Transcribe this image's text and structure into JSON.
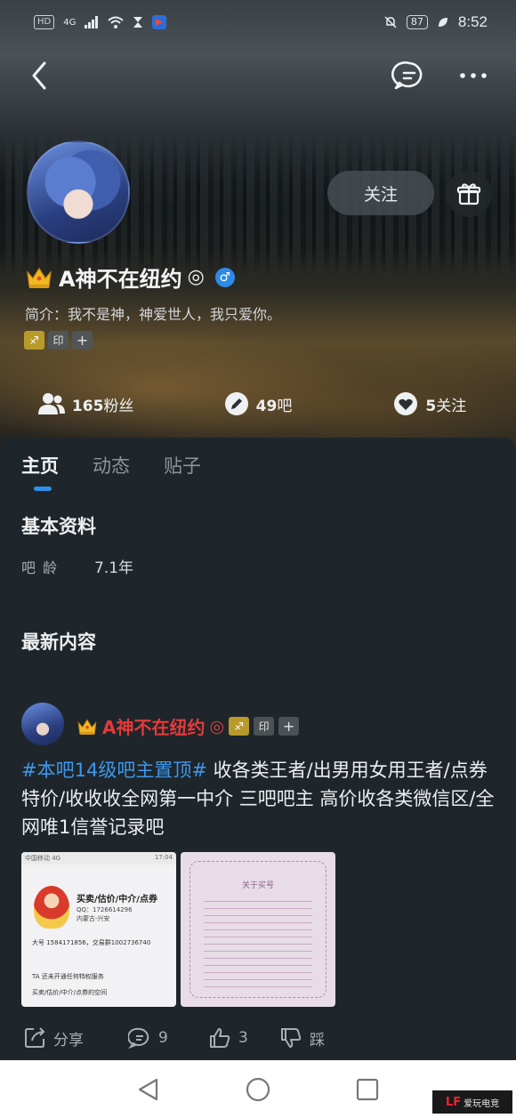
{
  "status_bar": {
    "left_hd": "HD",
    "left_net": "4G",
    "battery": "87",
    "time": "8:52"
  },
  "profile": {
    "username": "A神不在纽约",
    "ring_symbol": "◎",
    "gender_symbol": "♂",
    "bio": "简介：我不是神，神爱世人，我只爱你。",
    "follow_label": "关注",
    "tags": [
      "♐",
      "印",
      "+"
    ],
    "stats": {
      "fans_count": "165",
      "fans_label": "粉丝",
      "bars_count": "49",
      "bars_label": "吧",
      "following_count": "5",
      "following_label": "关注"
    }
  },
  "tabs": [
    {
      "label": "主页",
      "active": true
    },
    {
      "label": "动态",
      "active": false
    },
    {
      "label": "贴子",
      "active": false
    }
  ],
  "basic_info": {
    "title": "基本资料",
    "age_label": "吧龄",
    "age_value": "7.1年"
  },
  "latest": {
    "title": "最新内容"
  },
  "post": {
    "author": "A神不在纽约",
    "ring_symbol": "◎",
    "tags": [
      "♐",
      "印",
      "+"
    ],
    "hashtag": "#本吧14级吧主置顶#",
    "text": " 收各类王者/出男用女用王者/点券特价/收收收全网第一中介 三吧吧主 高价收各类微信区/全网唯1信誉记录吧",
    "image1": {
      "carrier": "中国移动 4G",
      "time": "17:04",
      "title": "买卖/估价/中介/点券",
      "qq": "QQ：1726614296",
      "location": "内蒙古-兴安",
      "line1": "大号 1584171856，交易群1002736740",
      "line2": "TA 还未开通任何特权服务",
      "line3": "买卖/估价/中介/点券的空间"
    },
    "image2": {
      "title": "关于买号"
    },
    "actions": {
      "share": "分享",
      "comments": "9",
      "likes": "3",
      "dislike": "踩"
    }
  },
  "watermark": {
    "logo": "LF",
    "text": "爱玩电竞"
  }
}
